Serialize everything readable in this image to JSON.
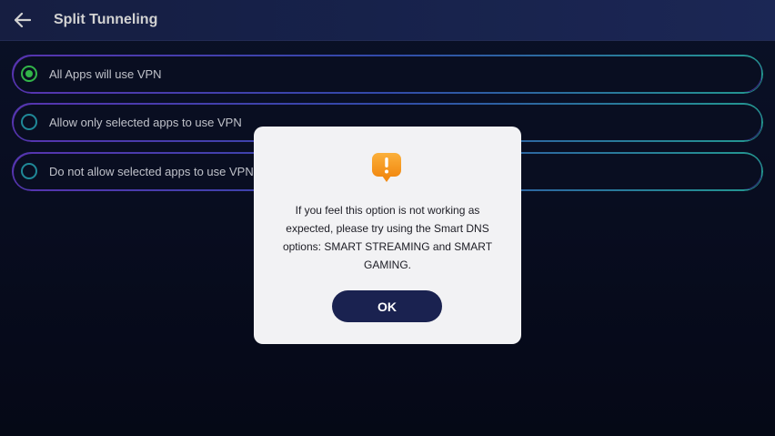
{
  "header": {
    "title": "Split Tunneling",
    "back_icon": "arrow-left-icon"
  },
  "options": [
    {
      "label": "All Apps will use VPN",
      "selected": true
    },
    {
      "label": "Allow only selected apps to use VPN",
      "selected": false
    },
    {
      "label": "Do not allow selected apps to use VPN",
      "selected": false
    }
  ],
  "dialog": {
    "icon": "warning-icon",
    "message": "If you feel this option is not working as expected, please try using the Smart DNS options: SMART STREAMING and SMART GAMING.",
    "ok_label": "OK"
  },
  "colors": {
    "accent_green": "#3ddc5a",
    "radio_teal": "#27a7b9",
    "warning_orange": "#f6961e",
    "button_navy": "#1a2250"
  }
}
